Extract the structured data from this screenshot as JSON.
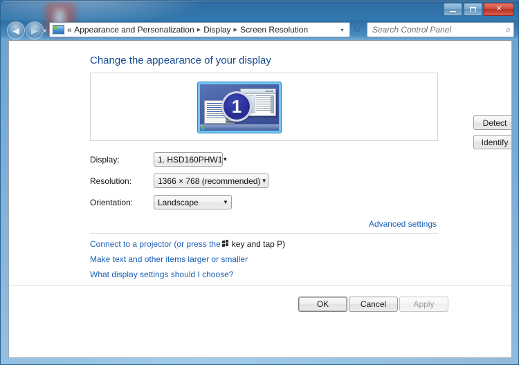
{
  "window": {
    "controls": {
      "minimize_label": "Minimize",
      "maximize_label": "Maximize",
      "close_label": "✕"
    }
  },
  "navbar": {
    "back_arrow": "◀",
    "forward_arrow": "▶",
    "recent_arrow": "▾",
    "breadcrumb": {
      "leading": "«",
      "items": [
        "Appearance and Personalization",
        "Display",
        "Screen Resolution"
      ],
      "separator": "▸",
      "dropdown_arrow": "▾"
    },
    "refresh_icon": "↻",
    "search": {
      "placeholder": "Search Control Panel",
      "icon": "⌕"
    }
  },
  "page": {
    "title": "Change the appearance of your display",
    "preview": {
      "monitor_number": "1"
    },
    "buttons": {
      "detect": "Detect",
      "identify": "Identify"
    },
    "fields": [
      {
        "label": "Display:",
        "value": "1. HSD160PHW1"
      },
      {
        "label": "Resolution:",
        "value": "1366 × 768 (recommended)"
      },
      {
        "label": "Orientation:",
        "value": "Landscape"
      }
    ],
    "combo_arrow": "▼",
    "advanced_settings": "Advanced settings",
    "links": {
      "projector_before": "Connect to a projector (or press the",
      "projector_after": "key and tap P)",
      "text_size": "Make text and other items larger or smaller",
      "choose": "What display settings should I choose?"
    },
    "dialog_buttons": {
      "ok": "OK",
      "cancel": "Cancel",
      "apply": "Apply"
    }
  },
  "colors": {
    "title_blue": "#2e6da4",
    "link_blue": "#1a5fb4",
    "heading_blue": "#14498c",
    "close_red": "#c0392b",
    "monitor_select": "#6fc5ef"
  }
}
